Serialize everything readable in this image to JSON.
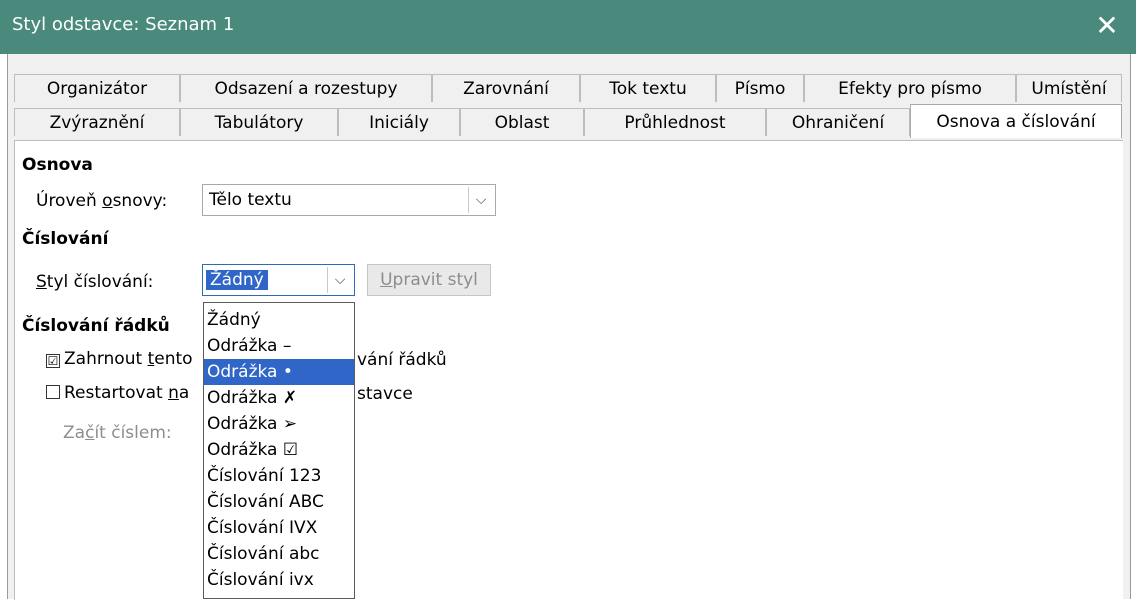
{
  "window": {
    "title": "Styl odstavce: Seznam 1",
    "close_glyph": "✕"
  },
  "tabs": {
    "row1": [
      "Organizátor",
      "Odsazení a rozestupy",
      "Zarovnání",
      "Tok textu",
      "Písmo",
      "Efekty pro písmo",
      "Umístění"
    ],
    "row2": [
      "Zvýraznění",
      "Tabulátory",
      "Iniciály",
      "Oblast",
      "Průhlednost",
      "Ohraničení",
      "Osnova a číslování"
    ],
    "active": "Osnova a číslování"
  },
  "outline": {
    "heading": "Osnova",
    "level_label_pre": "Úroveň ",
    "level_label_u": "o",
    "level_label_post": "snovy:",
    "level_value": "Tělo textu"
  },
  "numbering": {
    "heading": "Číslování",
    "style_label_u": "S",
    "style_label_post": "tyl číslování:",
    "style_value": "Žádný",
    "edit_u": "U",
    "edit_post": "pravit styl"
  },
  "line_numbering": {
    "heading": "Číslování řádků",
    "include_pre": "Zahrnout ",
    "include_u": "t",
    "include_post": "ento",
    "include_tail": "vání řádků",
    "include_checked": true,
    "restart_pre": "Restartovat ",
    "restart_u": "n",
    "restart_post": "a ",
    "restart_tail": "stavce",
    "restart_checked": false,
    "start_pre": "Za",
    "start_u": "č",
    "start_post": "ít číslem:"
  },
  "dropdown": {
    "options": [
      "Žádný",
      "Odrážka –",
      "Odrážka •",
      "Odrážka ✗",
      "Odrážka ➢",
      "Odrážka ☑",
      "Číslování 123",
      "Číslování ABC",
      "Číslování IVX",
      "Číslování abc",
      "Číslování ivx"
    ],
    "selected": "Odrážka •"
  },
  "colors": {
    "titlebar": "#4a8a7c",
    "selection": "#2f66c8"
  },
  "icons": {
    "dropdown_arrow": "chevron-down-icon",
    "check": "☑",
    "close": "close-icon"
  }
}
